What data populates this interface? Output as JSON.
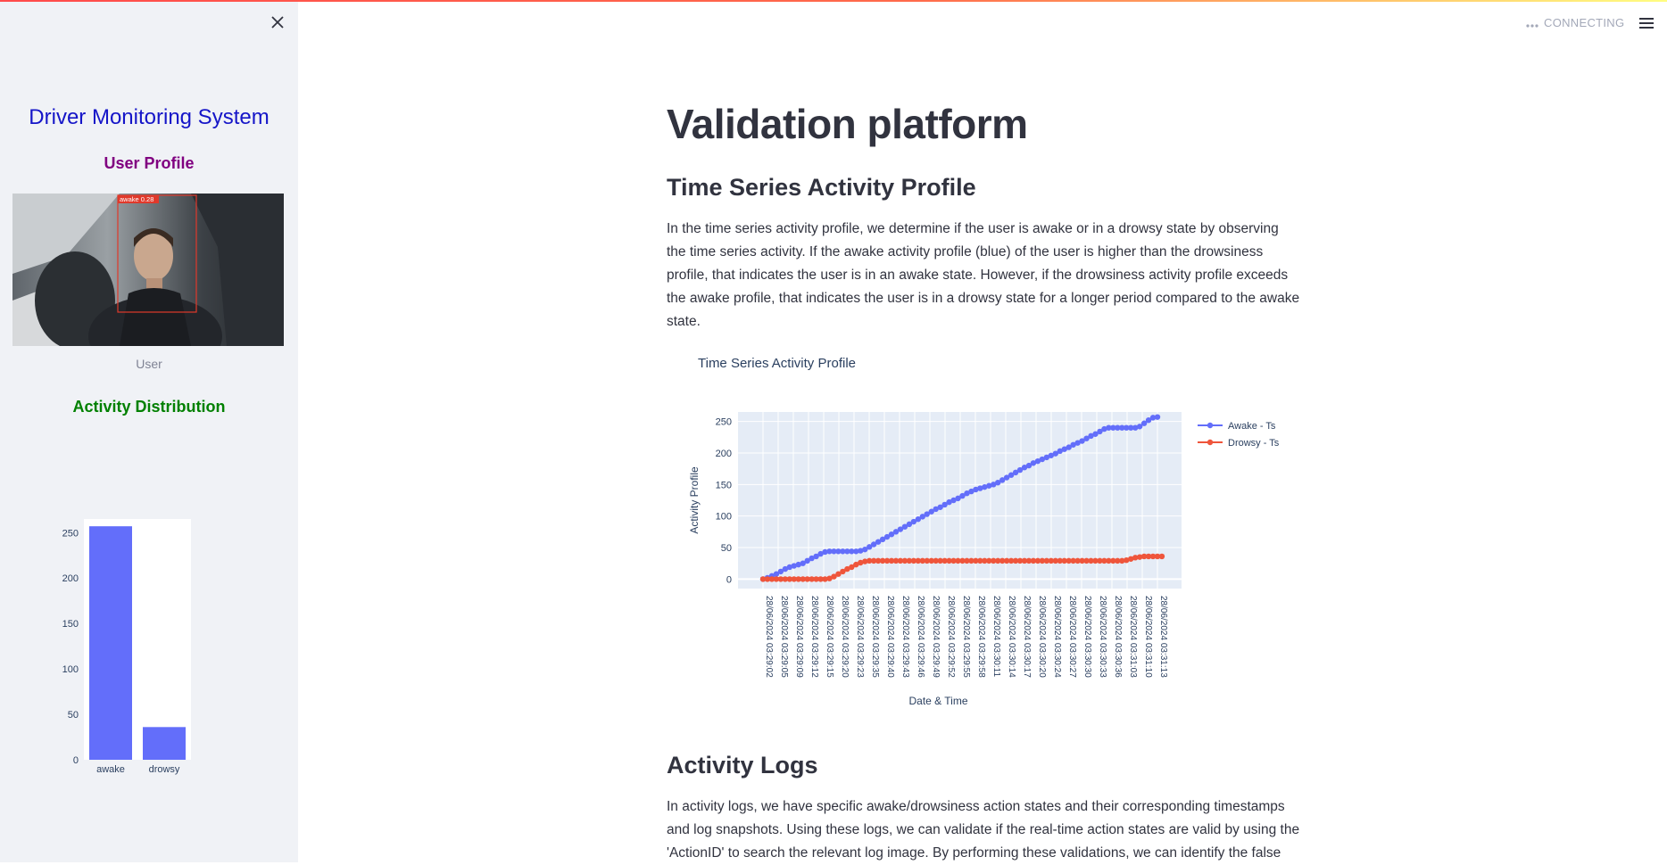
{
  "header": {
    "status_text": "CONNECTING",
    "status_icon": "dots-icon",
    "menu_icon": "hamburger-icon"
  },
  "sidebar": {
    "close_icon": "close-icon",
    "title": "Driver Monitoring System",
    "user_profile_heading": "User Profile",
    "photo_caption": "User",
    "detection_label": "awake  0.28",
    "activity_heading": "Activity Distribution"
  },
  "main": {
    "page_title": "Validation platform",
    "section1_title": "Time Series Activity Profile",
    "section1_text": "In the time series activity profile, we determine if the user is awake or in a drowsy state by observing the time series activity. If the awake activity profile (blue) of the user is higher than the drowsiness profile, that indicates the user is in an awake state. However, if the drowsiness activity profile exceeds the awake profile, that indicates the user is in a drowsy state for a longer period compared to the awake state.",
    "section2_title": "Activity Logs",
    "section2_text": "In activity logs, we have specific awake/drowsiness action states and their corresponding timestamps and log snapshots. Using these logs, we can validate if the real-time action states are valid by using the 'ActionID' to search the relevant log image. By performing these validations, we can identify the false"
  },
  "colors": {
    "awake": "#636efa",
    "drowsy": "#ef553b",
    "title_blue": "#1515c8",
    "purple": "#800080",
    "green": "#008000"
  },
  "chart_data": [
    {
      "type": "bar",
      "categories": [
        "awake",
        "drowsy"
      ],
      "values": [
        257,
        36
      ],
      "ylim": [
        0,
        265
      ],
      "yticks": [
        0,
        50,
        100,
        150,
        200,
        250
      ],
      "color": "#636efa"
    },
    {
      "type": "line",
      "title": "Time Series Activity Profile",
      "xlabel": "Date & Time",
      "ylabel": "Activity Profile",
      "ylim": [
        -15,
        265
      ],
      "yticks": [
        0,
        50,
        100,
        150,
        200,
        250
      ],
      "legend_position": "top-right",
      "x_tick_labels": [
        "28/06/2024 03:29:02",
        "28/06/2024 03:29:05",
        "28/06/2024 03:29:09",
        "28/06/2024 03:29:12",
        "28/06/2024 03:29:15",
        "28/06/2024 03:29:20",
        "28/06/2024 03:29:23",
        "28/06/2024 03:29:35",
        "28/06/2024 03:29:40",
        "28/06/2024 03:29:43",
        "28/06/2024 03:29:46",
        "28/06/2024 03:29:49",
        "28/06/2024 03:29:52",
        "28/06/2024 03:29:55",
        "28/06/2024 03:29:58",
        "28/06/2024 03:30:11",
        "28/06/2024 03:30:14",
        "28/06/2024 03:30:17",
        "28/06/2024 03:30:20",
        "28/06/2024 03:30:24",
        "28/06/2024 03:30:27",
        "28/06/2024 03:30:30",
        "28/06/2024 03:30:33",
        "28/06/2024 03:30:36",
        "28/06/2024 03:31:03",
        "28/06/2024 03:31:10",
        "28/06/2024 03:31:13"
      ],
      "series": [
        {
          "name": "Awake - Ts",
          "color": "#636efa",
          "values": [
            0,
            2,
            5,
            8,
            12,
            16,
            19,
            21,
            23,
            25,
            29,
            33,
            36,
            40,
            43,
            44,
            44,
            44,
            44,
            44,
            44,
            44,
            45,
            47,
            51,
            55,
            59,
            63,
            67,
            71,
            75,
            79,
            83,
            87,
            91,
            95,
            99,
            103,
            107,
            111,
            114,
            118,
            122,
            125,
            128,
            132,
            136,
            139,
            142,
            144,
            146,
            148,
            150,
            153,
            157,
            161,
            165,
            169,
            173,
            177,
            180,
            184,
            187,
            190,
            193,
            196,
            199,
            203,
            206,
            209,
            213,
            216,
            219,
            223,
            227,
            230,
            234,
            238,
            240,
            240,
            240,
            240,
            240,
            240,
            240,
            242,
            247,
            252,
            256,
            257
          ]
        },
        {
          "name": "Drowsy - Ts",
          "color": "#ef553b",
          "values": [
            0,
            0,
            0,
            0,
            0,
            0,
            0,
            0,
            0,
            0,
            0,
            0,
            0,
            0,
            0,
            1,
            4,
            8,
            12,
            16,
            19,
            23,
            26,
            28,
            29,
            29,
            29,
            29,
            29,
            29,
            29,
            29,
            29,
            29,
            29,
            29,
            29,
            29,
            29,
            29,
            29,
            29,
            29,
            29,
            29,
            29,
            29,
            29,
            29,
            29,
            29,
            29,
            29,
            29,
            29,
            29,
            29,
            29,
            29,
            29,
            29,
            29,
            29,
            29,
            29,
            29,
            29,
            29,
            29,
            29,
            29,
            29,
            29,
            29,
            29,
            29,
            29,
            29,
            29,
            29,
            29,
            29,
            30,
            32,
            34,
            35,
            36,
            36,
            36,
            36,
            36
          ]
        }
      ]
    }
  ]
}
